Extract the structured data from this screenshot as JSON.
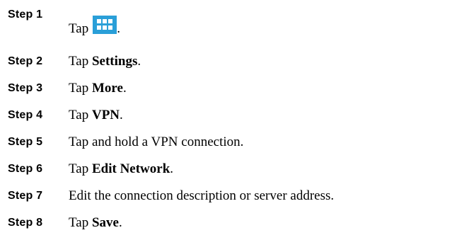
{
  "steps": [
    {
      "label": "Step 1",
      "prefix": "Tap",
      "bold": "",
      "suffix": ".",
      "icon": "apps-grid-icon",
      "icon_color": "#2a9fd8"
    },
    {
      "label": "Step 2",
      "prefix": "Tap ",
      "bold": "Settings",
      "suffix": "."
    },
    {
      "label": "Step 3",
      "prefix": "Tap ",
      "bold": "More",
      "suffix": "."
    },
    {
      "label": "Step 4",
      "prefix": "Tap ",
      "bold": "VPN",
      "suffix": "."
    },
    {
      "label": "Step 5",
      "prefix": "Tap and hold a VPN connection.",
      "bold": "",
      "suffix": ""
    },
    {
      "label": "Step 6",
      "prefix": "Tap ",
      "bold": "Edit Network",
      "suffix": "."
    },
    {
      "label": "Step 7",
      "prefix": "Edit the connection description or server address.",
      "bold": "",
      "suffix": ""
    },
    {
      "label": "Step 8",
      "prefix": "Tap ",
      "bold": "Save",
      "suffix": "."
    }
  ]
}
